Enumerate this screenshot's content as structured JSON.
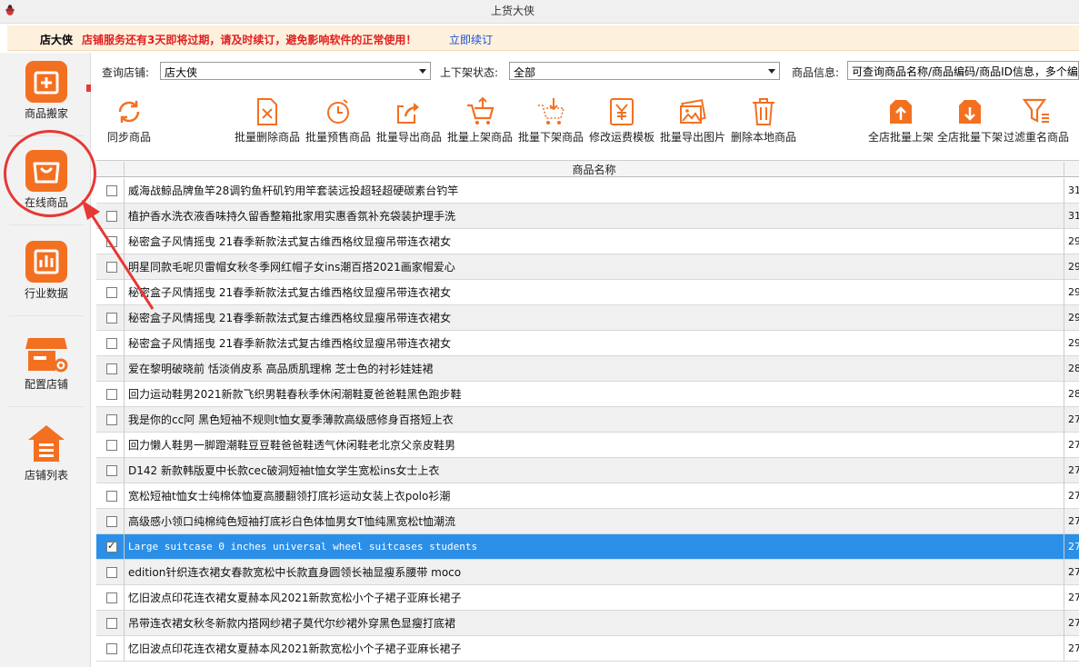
{
  "window": {
    "title": "上货大侠"
  },
  "notice": {
    "shop_name": "店大侠",
    "message": "店铺服务还有3天即将过期，请及时续订，避免影响软件的正常使用！",
    "renew_link": "立即续订"
  },
  "sidebar": {
    "items": [
      {
        "label": "商品搬家",
        "icon": "box-plus-icon"
      },
      {
        "label": "在线商品",
        "icon": "shopping-bag-icon"
      },
      {
        "label": "行业数据",
        "icon": "bar-chart-icon"
      },
      {
        "label": "配置店铺",
        "icon": "store-gear-icon"
      },
      {
        "label": "店铺列表",
        "icon": "store-list-icon"
      }
    ]
  },
  "filters": {
    "shop_label": "查询店铺:",
    "shop_value": "店大侠",
    "status_label": "上下架状态:",
    "status_value": "全部",
    "info_label": "商品信息:",
    "info_value": "可查询商品名称/商品编码/商品ID信息，多个编"
  },
  "toolbar": {
    "sync": "同步商品",
    "batch_delete": "批量删除商品",
    "batch_presale": "批量预售商品",
    "batch_export": "批量导出商品",
    "batch_onshelf": "批量上架商品",
    "batch_offshelf": "批量下架商品",
    "edit_shipping": "修改运费模板",
    "export_images": "批量导出图片",
    "delete_local": "删除本地商品",
    "shop_onshelf": "全店批量上架",
    "shop_offshelf": "全店批量下架",
    "filter_duplicate": "过滤重名商品"
  },
  "table": {
    "header": "商品名称",
    "rows": [
      {
        "name": "威海战鲸品牌鱼竿28调钓鱼杆矶钓用竿套装远投超轻超硬碳素台钓竿",
        "num": "31",
        "checked": false
      },
      {
        "name": "植护香水洗衣液香味持久留香整箱批家用实惠香氛补充袋装护理手洗",
        "num": "31",
        "checked": false
      },
      {
        "name": "秘密盒子风情摇曳 21春季新款法式复古维西格纹显瘦吊带连衣裙女",
        "num": "29",
        "checked": false
      },
      {
        "name": "明星同款毛呢贝雷帽女秋冬季网红帽子女ins潮百搭2021画家帽爱心",
        "num": "29",
        "checked": false
      },
      {
        "name": "秘密盒子风情摇曳 21春季新款法式复古维西格纹显瘦吊带连衣裙女",
        "num": "29",
        "checked": false
      },
      {
        "name": "秘密盒子风情摇曳 21春季新款法式复古维西格纹显瘦吊带连衣裙女",
        "num": "29",
        "checked": false
      },
      {
        "name": "秘密盒子风情摇曳 21春季新款法式复古维西格纹显瘦吊带连衣裙女",
        "num": "29",
        "checked": false
      },
      {
        "name": "爱在黎明破晓前 恬淡俏皮系 高品质肌理棉 芝士色的衬衫娃娃裙",
        "num": "28",
        "checked": false
      },
      {
        "name": "回力运动鞋男2021新款飞织男鞋春秋季休闲潮鞋夏爸爸鞋黑色跑步鞋",
        "num": "28",
        "checked": false
      },
      {
        "name": "我是你的cc阿 黑色短袖不规则t恤女夏季薄款高级感修身百搭短上衣",
        "num": "27",
        "checked": false
      },
      {
        "name": "回力懒人鞋男一脚蹬潮鞋豆豆鞋爸爸鞋透气休闲鞋老北京父亲皮鞋男",
        "num": "27",
        "checked": false
      },
      {
        "name": "D142 新款韩版夏中长款cec破洞短袖t恤女学生宽松ins女士上衣",
        "num": "27",
        "checked": false
      },
      {
        "name": "宽松短袖t恤女士纯棉体恤夏高腰翻领打底衫运动女装上衣polo衫潮",
        "num": "27",
        "checked": false
      },
      {
        "name": "高级感小领口纯棉纯色短袖打底衫白色体恤男女T恤纯黑宽松t恤潮流",
        "num": "27",
        "checked": false
      },
      {
        "name": "Large suitcase 0 inches universal wheel suitcases students",
        "num": "27",
        "checked": true
      },
      {
        "name": "edition针织连衣裙女春款宽松中长款直身圆领长袖显瘦系腰带 moco",
        "num": "27",
        "checked": false
      },
      {
        "name": "忆旧波点印花连衣裙女夏赫本风2021新款宽松小个子裙子亚麻长裙子",
        "num": "27",
        "checked": false
      },
      {
        "name": "吊带连衣裙女秋冬新款内搭网纱裙子莫代尔纱裙外穿黑色显瘦打底裙",
        "num": "27",
        "checked": false
      },
      {
        "name": "忆旧波点印花连衣裙女夏赫本风2021新款宽松小个子裙子亚麻长裙子",
        "num": "27",
        "checked": false
      }
    ]
  }
}
